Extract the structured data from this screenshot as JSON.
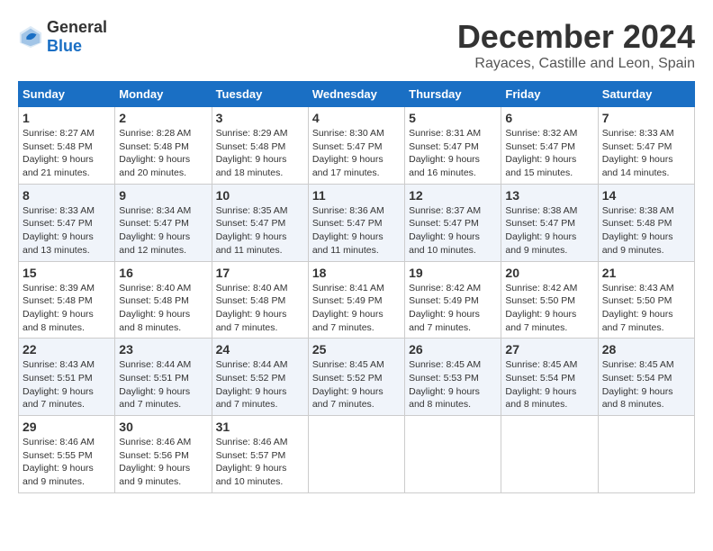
{
  "header": {
    "logo_general": "General",
    "logo_blue": "Blue",
    "month_title": "December 2024",
    "location": "Rayaces, Castille and Leon, Spain"
  },
  "weekdays": [
    "Sunday",
    "Monday",
    "Tuesday",
    "Wednesday",
    "Thursday",
    "Friday",
    "Saturday"
  ],
  "weeks": [
    [
      {
        "day": "1",
        "sunrise": "8:27 AM",
        "sunset": "5:48 PM",
        "daylight": "9 hours and 21 minutes."
      },
      {
        "day": "2",
        "sunrise": "8:28 AM",
        "sunset": "5:48 PM",
        "daylight": "9 hours and 20 minutes."
      },
      {
        "day": "3",
        "sunrise": "8:29 AM",
        "sunset": "5:48 PM",
        "daylight": "9 hours and 18 minutes."
      },
      {
        "day": "4",
        "sunrise": "8:30 AM",
        "sunset": "5:47 PM",
        "daylight": "9 hours and 17 minutes."
      },
      {
        "day": "5",
        "sunrise": "8:31 AM",
        "sunset": "5:47 PM",
        "daylight": "9 hours and 16 minutes."
      },
      {
        "day": "6",
        "sunrise": "8:32 AM",
        "sunset": "5:47 PM",
        "daylight": "9 hours and 15 minutes."
      },
      {
        "day": "7",
        "sunrise": "8:33 AM",
        "sunset": "5:47 PM",
        "daylight": "9 hours and 14 minutes."
      }
    ],
    [
      {
        "day": "8",
        "sunrise": "8:33 AM",
        "sunset": "5:47 PM",
        "daylight": "9 hours and 13 minutes."
      },
      {
        "day": "9",
        "sunrise": "8:34 AM",
        "sunset": "5:47 PM",
        "daylight": "9 hours and 12 minutes."
      },
      {
        "day": "10",
        "sunrise": "8:35 AM",
        "sunset": "5:47 PM",
        "daylight": "9 hours and 11 minutes."
      },
      {
        "day": "11",
        "sunrise": "8:36 AM",
        "sunset": "5:47 PM",
        "daylight": "9 hours and 11 minutes."
      },
      {
        "day": "12",
        "sunrise": "8:37 AM",
        "sunset": "5:47 PM",
        "daylight": "9 hours and 10 minutes."
      },
      {
        "day": "13",
        "sunrise": "8:38 AM",
        "sunset": "5:47 PM",
        "daylight": "9 hours and 9 minutes."
      },
      {
        "day": "14",
        "sunrise": "8:38 AM",
        "sunset": "5:48 PM",
        "daylight": "9 hours and 9 minutes."
      }
    ],
    [
      {
        "day": "15",
        "sunrise": "8:39 AM",
        "sunset": "5:48 PM",
        "daylight": "9 hours and 8 minutes."
      },
      {
        "day": "16",
        "sunrise": "8:40 AM",
        "sunset": "5:48 PM",
        "daylight": "9 hours and 8 minutes."
      },
      {
        "day": "17",
        "sunrise": "8:40 AM",
        "sunset": "5:48 PM",
        "daylight": "9 hours and 7 minutes."
      },
      {
        "day": "18",
        "sunrise": "8:41 AM",
        "sunset": "5:49 PM",
        "daylight": "9 hours and 7 minutes."
      },
      {
        "day": "19",
        "sunrise": "8:42 AM",
        "sunset": "5:49 PM",
        "daylight": "9 hours and 7 minutes."
      },
      {
        "day": "20",
        "sunrise": "8:42 AM",
        "sunset": "5:50 PM",
        "daylight": "9 hours and 7 minutes."
      },
      {
        "day": "21",
        "sunrise": "8:43 AM",
        "sunset": "5:50 PM",
        "daylight": "9 hours and 7 minutes."
      }
    ],
    [
      {
        "day": "22",
        "sunrise": "8:43 AM",
        "sunset": "5:51 PM",
        "daylight": "9 hours and 7 minutes."
      },
      {
        "day": "23",
        "sunrise": "8:44 AM",
        "sunset": "5:51 PM",
        "daylight": "9 hours and 7 minutes."
      },
      {
        "day": "24",
        "sunrise": "8:44 AM",
        "sunset": "5:52 PM",
        "daylight": "9 hours and 7 minutes."
      },
      {
        "day": "25",
        "sunrise": "8:45 AM",
        "sunset": "5:52 PM",
        "daylight": "9 hours and 7 minutes."
      },
      {
        "day": "26",
        "sunrise": "8:45 AM",
        "sunset": "5:53 PM",
        "daylight": "9 hours and 8 minutes."
      },
      {
        "day": "27",
        "sunrise": "8:45 AM",
        "sunset": "5:54 PM",
        "daylight": "9 hours and 8 minutes."
      },
      {
        "day": "28",
        "sunrise": "8:45 AM",
        "sunset": "5:54 PM",
        "daylight": "9 hours and 8 minutes."
      }
    ],
    [
      {
        "day": "29",
        "sunrise": "8:46 AM",
        "sunset": "5:55 PM",
        "daylight": "9 hours and 9 minutes."
      },
      {
        "day": "30",
        "sunrise": "8:46 AM",
        "sunset": "5:56 PM",
        "daylight": "9 hours and 9 minutes."
      },
      {
        "day": "31",
        "sunrise": "8:46 AM",
        "sunset": "5:57 PM",
        "daylight": "9 hours and 10 minutes."
      },
      null,
      null,
      null,
      null
    ]
  ],
  "labels": {
    "sunrise": "Sunrise: ",
    "sunset": "Sunset: ",
    "daylight": "Daylight: "
  }
}
